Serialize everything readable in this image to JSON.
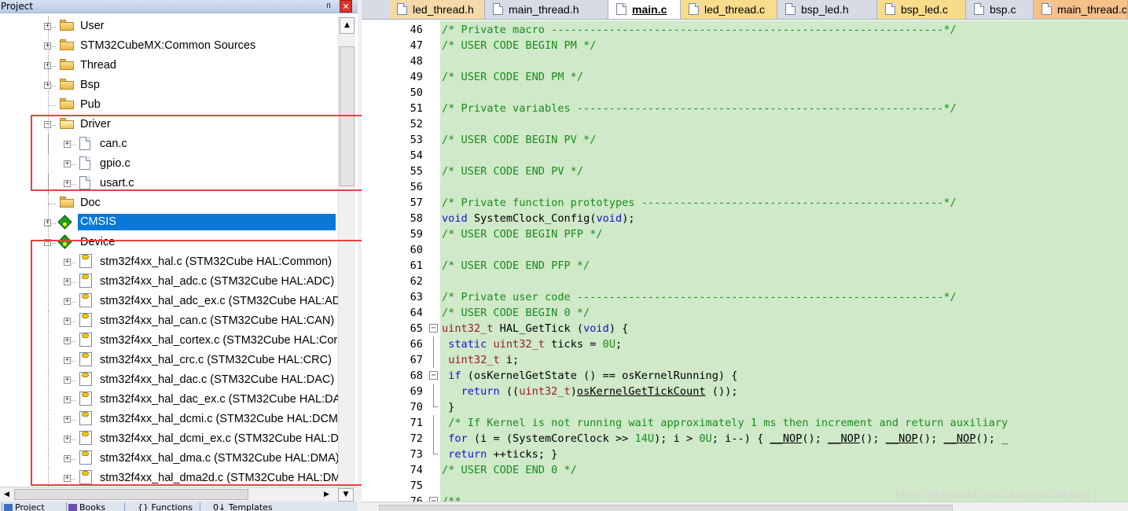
{
  "project_panel": {
    "title": "Project",
    "pin_glyph": "ᴨ",
    "close_glyph": "✕",
    "tree": [
      {
        "label": "User",
        "kind": "folder",
        "expander": "+"
      },
      {
        "label": "STM32CubeMX:Common Sources",
        "kind": "folder",
        "expander": "+"
      },
      {
        "label": "Thread",
        "kind": "folder",
        "expander": "+"
      },
      {
        "label": "Bsp",
        "kind": "folder",
        "expander": "+"
      },
      {
        "label": "Pub",
        "kind": "folder",
        "expander": ""
      },
      {
        "label": "Driver",
        "kind": "folder-open",
        "expander": "−"
      },
      {
        "label": "can.c",
        "kind": "file",
        "expander": "+"
      },
      {
        "label": "gpio.c",
        "kind": "file",
        "expander": "+"
      },
      {
        "label": "usart.c",
        "kind": "file",
        "expander": "+"
      },
      {
        "label": "Doc",
        "kind": "folder",
        "expander": ""
      },
      {
        "label": "CMSIS",
        "kind": "component",
        "expander": "+",
        "selected": true
      },
      {
        "label": "Device",
        "kind": "component",
        "expander": "−"
      },
      {
        "label": "stm32f4xx_hal.c (STM32Cube HAL:Common)",
        "kind": "hal",
        "expander": "+"
      },
      {
        "label": "stm32f4xx_hal_adc.c (STM32Cube HAL:ADC)",
        "kind": "hal",
        "expander": "+"
      },
      {
        "label": "stm32f4xx_hal_adc_ex.c (STM32Cube HAL:AD",
        "kind": "hal",
        "expander": "+"
      },
      {
        "label": "stm32f4xx_hal_can.c (STM32Cube HAL:CAN)",
        "kind": "hal",
        "expander": "+"
      },
      {
        "label": "stm32f4xx_hal_cortex.c (STM32Cube HAL:Cor",
        "kind": "hal",
        "expander": "+"
      },
      {
        "label": "stm32f4xx_hal_crc.c (STM32Cube HAL:CRC)",
        "kind": "hal",
        "expander": "+"
      },
      {
        "label": "stm32f4xx_hal_dac.c (STM32Cube HAL:DAC)",
        "kind": "hal",
        "expander": "+"
      },
      {
        "label": "stm32f4xx_hal_dac_ex.c (STM32Cube HAL:DA",
        "kind": "hal",
        "expander": "+"
      },
      {
        "label": "stm32f4xx_hal_dcmi.c (STM32Cube HAL:DCM",
        "kind": "hal",
        "expander": "+"
      },
      {
        "label": "stm32f4xx_hal_dcmi_ex.c (STM32Cube HAL:D",
        "kind": "hal",
        "expander": "+"
      },
      {
        "label": "stm32f4xx_hal_dma.c (STM32Cube HAL:DMA)",
        "kind": "hal",
        "expander": "+"
      },
      {
        "label": "stm32f4xx_hal_dma2d.c (STM32Cube HAL:DM",
        "kind": "hal",
        "expander": "+"
      }
    ],
    "bottom_tabs": [
      "Project",
      "Books",
      "{} Functions",
      "0↓ Templates"
    ]
  },
  "editor": {
    "tabs": [
      {
        "label": "led_thread.h",
        "color": "#f5d9a8",
        "active": false
      },
      {
        "label": "main_thread.h",
        "color": "#d6dbe6",
        "active": false
      },
      {
        "label": "main.c",
        "color": "#ffffff",
        "active": true
      },
      {
        "label": "led_thread.c",
        "color": "#f7dc8c",
        "active": false
      },
      {
        "label": "bsp_led.h",
        "color": "#d6dbe6",
        "active": false
      },
      {
        "label": "bsp_led.c",
        "color": "#f7dc8c",
        "active": false
      },
      {
        "label": "bsp.c",
        "color": "#d6dbe6",
        "active": false
      },
      {
        "label": "main_thread.c",
        "color": "#f5c08a",
        "active": false
      }
    ],
    "lines": [
      {
        "n": "46",
        "code": [
          [
            "c",
            "/* Private macro -------------------------------------------------------------*/"
          ]
        ]
      },
      {
        "n": "47",
        "code": [
          [
            "c",
            "/* USER CODE BEGIN PM */"
          ]
        ]
      },
      {
        "n": "48",
        "code": []
      },
      {
        "n": "49",
        "code": [
          [
            "c",
            "/* USER CODE END PM */"
          ]
        ]
      },
      {
        "n": "50",
        "code": []
      },
      {
        "n": "51",
        "code": [
          [
            "c",
            "/* Private variables ---------------------------------------------------------*/"
          ]
        ]
      },
      {
        "n": "52",
        "code": []
      },
      {
        "n": "53",
        "code": [
          [
            "c",
            "/* USER CODE BEGIN PV */"
          ]
        ]
      },
      {
        "n": "54",
        "code": []
      },
      {
        "n": "55",
        "code": [
          [
            "c",
            "/* USER CODE END PV */"
          ]
        ]
      },
      {
        "n": "56",
        "code": []
      },
      {
        "n": "57",
        "code": [
          [
            "c",
            "/* Private function prototypes -----------------------------------------------*/"
          ]
        ]
      },
      {
        "n": "58",
        "code": [
          [
            "k",
            "void"
          ],
          [
            "p",
            " SystemClock_Config("
          ],
          [
            "k",
            "void"
          ],
          [
            "p",
            ");"
          ]
        ]
      },
      {
        "n": "59",
        "code": [
          [
            "c",
            "/* USER CODE BEGIN PFP */"
          ]
        ]
      },
      {
        "n": "60",
        "code": []
      },
      {
        "n": "61",
        "code": [
          [
            "c",
            "/* USER CODE END PFP */"
          ]
        ]
      },
      {
        "n": "62",
        "code": []
      },
      {
        "n": "63",
        "code": [
          [
            "c",
            "/* Private user code ---------------------------------------------------------*/"
          ]
        ]
      },
      {
        "n": "64",
        "code": [
          [
            "c",
            "/* USER CODE BEGIN 0 */"
          ]
        ]
      },
      {
        "n": "65",
        "fold": "box",
        "code": [
          [
            "t",
            "uint32_t"
          ],
          [
            "p",
            " HAL_GetTick ("
          ],
          [
            "k",
            "void"
          ],
          [
            "p",
            ") {"
          ]
        ]
      },
      {
        "n": "66",
        "fold": "line",
        "code": [
          [
            "p",
            " "
          ],
          [
            "k",
            "static"
          ],
          [
            "p",
            " "
          ],
          [
            "t",
            "uint32_t"
          ],
          [
            "p",
            " ticks = "
          ],
          [
            "n",
            "0U"
          ],
          [
            "p",
            ";"
          ]
        ]
      },
      {
        "n": "67",
        "fold": "line",
        "code": [
          [
            "p",
            " "
          ],
          [
            "t",
            "uint32_t"
          ],
          [
            "p",
            " i;"
          ]
        ]
      },
      {
        "n": "68",
        "fold": "box",
        "code": [
          [
            "p",
            " "
          ],
          [
            "k",
            "if"
          ],
          [
            "p",
            " (osKernelGetState () == osKernelRunning) {"
          ]
        ]
      },
      {
        "n": "69",
        "fold": "line",
        "code": [
          [
            "p",
            "   "
          ],
          [
            "k",
            "return"
          ],
          [
            "p",
            " (("
          ],
          [
            "t",
            "uint32_t"
          ],
          [
            "p",
            ")"
          ],
          [
            "u",
            "osKernelGetTickCount"
          ],
          [
            "p",
            " ());"
          ]
        ]
      },
      {
        "n": "70",
        "fold": "end",
        "code": [
          [
            "p",
            " }"
          ]
        ]
      },
      {
        "n": "71",
        "fold": "line",
        "code": [
          [
            "p",
            " "
          ],
          [
            "c",
            "/* If Kernel is not running wait approximately 1 ms then increment and return auxiliary"
          ]
        ]
      },
      {
        "n": "72",
        "fold": "line",
        "code": [
          [
            "p",
            " "
          ],
          [
            "k",
            "for"
          ],
          [
            "p",
            " (i = (SystemCoreClock >> "
          ],
          [
            "n",
            "14U"
          ],
          [
            "p",
            "); i > "
          ],
          [
            "n",
            "0U"
          ],
          [
            "p",
            "; i--) { "
          ],
          [
            "u",
            "__NOP"
          ],
          [
            "p",
            "(); "
          ],
          [
            "u",
            "__NOP"
          ],
          [
            "p",
            "(); "
          ],
          [
            "u",
            "__NOP"
          ],
          [
            "p",
            "(); "
          ],
          [
            "u",
            "__NOP"
          ],
          [
            "p",
            "(); _"
          ]
        ]
      },
      {
        "n": "73",
        "fold": "end",
        "code": [
          [
            "p",
            " "
          ],
          [
            "k",
            "return"
          ],
          [
            "p",
            " ++ticks; }"
          ]
        ]
      },
      {
        "n": "74",
        "code": [
          [
            "c",
            "/* USER CODE END 0 */"
          ]
        ]
      },
      {
        "n": "75",
        "code": []
      },
      {
        "n": "76",
        "fold": "box",
        "code": [
          [
            "c",
            "/**"
          ]
        ]
      }
    ]
  },
  "watermark": "https://blog.csdn.net/oDuanYanGuHong"
}
